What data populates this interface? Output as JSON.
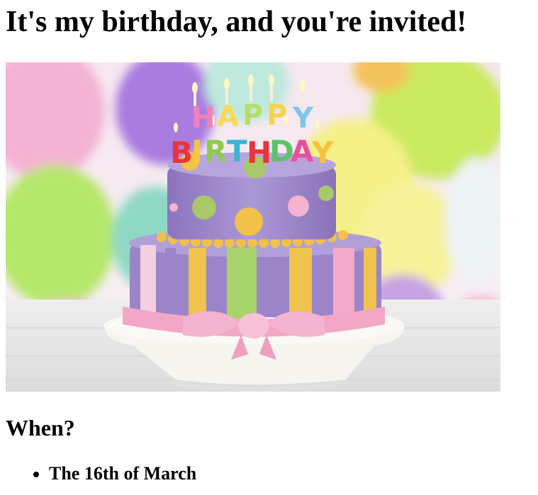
{
  "heading": "It's my birthday, and you're invited!",
  "image": {
    "alt": "Birthday cake with candles",
    "candle_letters_top": [
      "H",
      "A",
      "P",
      "P",
      "Y"
    ],
    "candle_letters_bottom": [
      "B",
      "I",
      "R",
      "T",
      "H",
      "D",
      "A",
      "Y"
    ],
    "colors": {
      "cake": "#9b84c8",
      "ribbon": "#f2a7c6",
      "stripe_yellow": "#f2c94c",
      "stripe_green": "#a8d36b"
    }
  },
  "section_heading": "When?",
  "details": [
    "The 16th of March"
  ]
}
